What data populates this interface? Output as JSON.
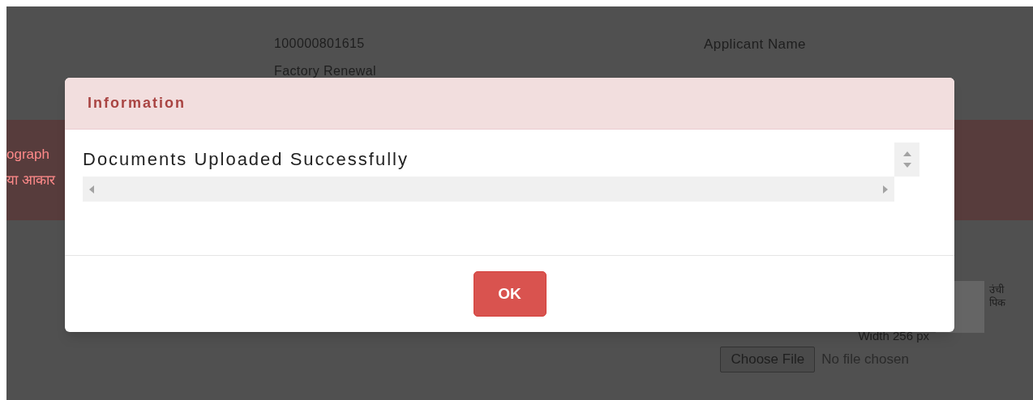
{
  "page": {
    "application_number": "100000801615",
    "applicant_label": "Applicant Name",
    "service": "Factory Renewal",
    "notice_line_1": "ograph",
    "notice_line_2": "या आकार",
    "width_label": "Width 256 px",
    "height_label_1": "उंची",
    "height_label_2": "पिक",
    "file_button": "Choose File",
    "file_status": "No file chosen"
  },
  "dialog": {
    "title": "Information",
    "message": "Documents Uploaded Successfully",
    "buttons": [
      "OK"
    ]
  }
}
